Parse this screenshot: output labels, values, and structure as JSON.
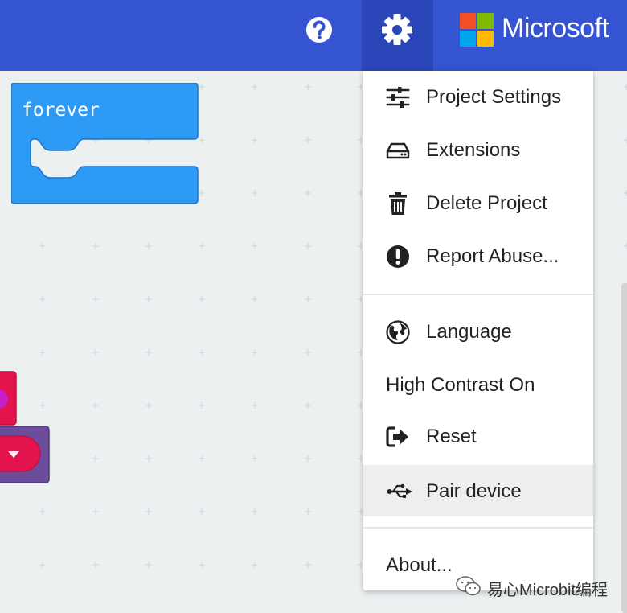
{
  "header": {
    "help_icon": "question-circle-icon",
    "settings_icon": "gear-icon",
    "brand": "Microsoft",
    "colors": {
      "bar": "#3454d1",
      "settings_active": "#2a46b9"
    }
  },
  "workspace": {
    "forever_block": {
      "label": "forever",
      "color": "#2d9af5"
    }
  },
  "settings_menu": {
    "items": [
      {
        "label": "Project Settings",
        "icon": "sliders-icon"
      },
      {
        "label": "Extensions",
        "icon": "drive-icon"
      },
      {
        "label": "Delete Project",
        "icon": "trash-icon"
      },
      {
        "label": "Report Abuse...",
        "icon": "exclamation-circle-icon"
      },
      {
        "label": "Language",
        "icon": "globe-icon"
      },
      {
        "label": "High Contrast On",
        "icon": ""
      },
      {
        "label": "Reset",
        "icon": "sign-out-icon"
      },
      {
        "label": "Pair device",
        "icon": "usb-icon",
        "highlighted": true
      },
      {
        "label": "About...",
        "icon": ""
      }
    ]
  },
  "watermark": {
    "text": "易心Microbit编程"
  }
}
